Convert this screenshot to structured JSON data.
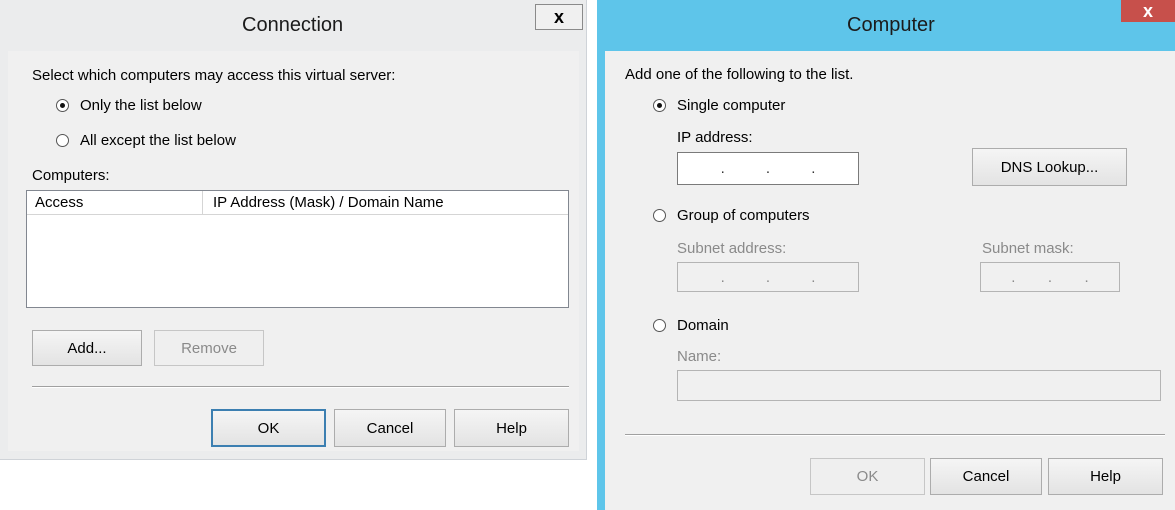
{
  "connection": {
    "title": "Connection",
    "close_label": "x",
    "prompt": "Select which computers may access this virtual server:",
    "radio_only_list": "Only the list below",
    "radio_all_except": "All except the list below",
    "computers_label": "Computers:",
    "columns": [
      "Access",
      "IP Address (Mask) / Domain Name"
    ],
    "add_label": "Add...",
    "remove_label": "Remove",
    "ok_label": "OK",
    "cancel_label": "Cancel",
    "help_label": "Help"
  },
  "computer": {
    "title": "Computer",
    "close_label": "x",
    "prompt": "Add one of the following to the list.",
    "radio_single": "Single computer",
    "ip_label": "IP address:",
    "ip_dots": [
      ".",
      ".",
      "."
    ],
    "dns_label": "DNS Lookup...",
    "radio_group": "Group of computers",
    "subnet_address_label": "Subnet address:",
    "subnet_mask_label": "Subnet mask:",
    "radio_domain": "Domain",
    "name_label": "Name:",
    "ok_label": "OK",
    "cancel_label": "Cancel",
    "help_label": "Help"
  },
  "colors": {
    "computer_titlebar": "#5ec5ea",
    "computer_close": "#c7504b",
    "default_button_border": "#3c7fb1"
  }
}
